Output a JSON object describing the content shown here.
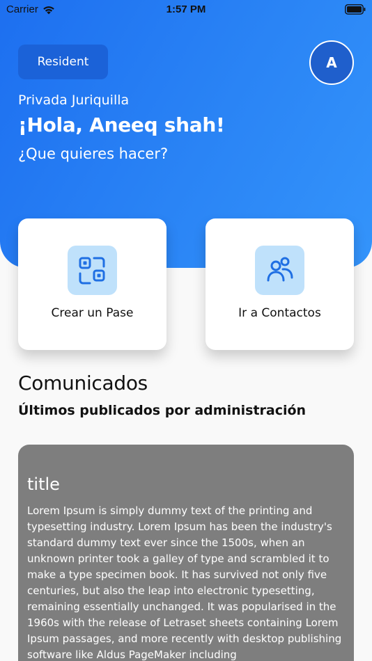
{
  "status_bar": {
    "carrier": "Carrier",
    "time": "1:57 PM"
  },
  "header": {
    "role": "Resident",
    "avatar_initial": "A",
    "community": "Privada Juriquilla",
    "greeting": "¡Hola, Aneeq shah!",
    "question": "¿Que quieres hacer?"
  },
  "actions": [
    {
      "label": "Crear un Pase",
      "icon": "qr-code-icon"
    },
    {
      "label": "Ir a Contactos",
      "icon": "contacts-icon"
    }
  ],
  "announcements": {
    "title": "Comunicados",
    "subtitle": "Últimos publicados por administración",
    "posts": [
      {
        "title": "title",
        "body": "Lorem Ipsum is simply dummy text of the printing and typesetting industry. Lorem Ipsum has been the industry's standard dummy text ever since the 1500s, when an unknown printer took a galley of type and scrambled it to make a type specimen book. It has survived not only five centuries, but also the leap into electronic typesetting, remaining essentially unchanged. It was popularised in the 1960s with the release of Letraset sheets containing Lorem Ipsum passages, and more recently with desktop publishing software like Aldus PageMaker including"
      }
    ]
  },
  "colors": {
    "primary_gradient_start": "#1d6ff0",
    "primary_gradient_end": "#3494fb",
    "icon_tile": "#bfe1fb",
    "icon_stroke": "#1f6fe3",
    "post_card": "#7e7e7e"
  }
}
